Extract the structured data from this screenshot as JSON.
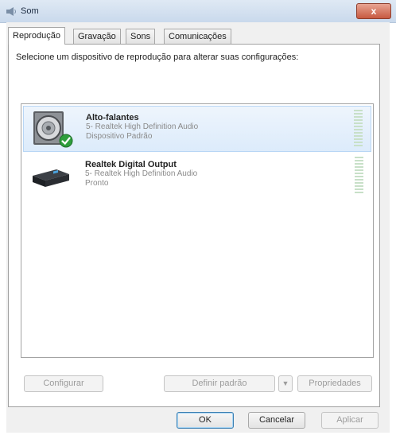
{
  "window": {
    "title": "Som",
    "close_label": "x"
  },
  "tabs": [
    {
      "label": "Reprodução",
      "active": true
    },
    {
      "label": "Gravação",
      "active": false
    },
    {
      "label": "Sons",
      "active": false
    },
    {
      "label": "Comunicações",
      "active": false
    }
  ],
  "instruction": "Selecione um dispositivo de reprodução para alterar suas configurações:",
  "devices": [
    {
      "name": "Alto-falantes",
      "driver": "5- Realtek High Definition Audio",
      "status": "Dispositivo Padrão",
      "icon": "speaker-icon",
      "selected": true,
      "is_default": true
    },
    {
      "name": "Realtek Digital Output",
      "driver": "5- Realtek High Definition Audio",
      "status": "Pronto",
      "icon": "digital-output-icon",
      "selected": false,
      "is_default": false
    }
  ],
  "buttons": {
    "configure": "Configurar",
    "set_default": "Definir padrão",
    "dropdown_arrow": "▼",
    "properties": "Propriedades",
    "ok": "OK",
    "cancel": "Cancelar",
    "apply": "Aplicar"
  },
  "colors": {
    "titlebar": "#c9d9ec",
    "close_button": "#c75a41",
    "selection": "#dcebfb",
    "default_check": "#2e9e3c"
  }
}
